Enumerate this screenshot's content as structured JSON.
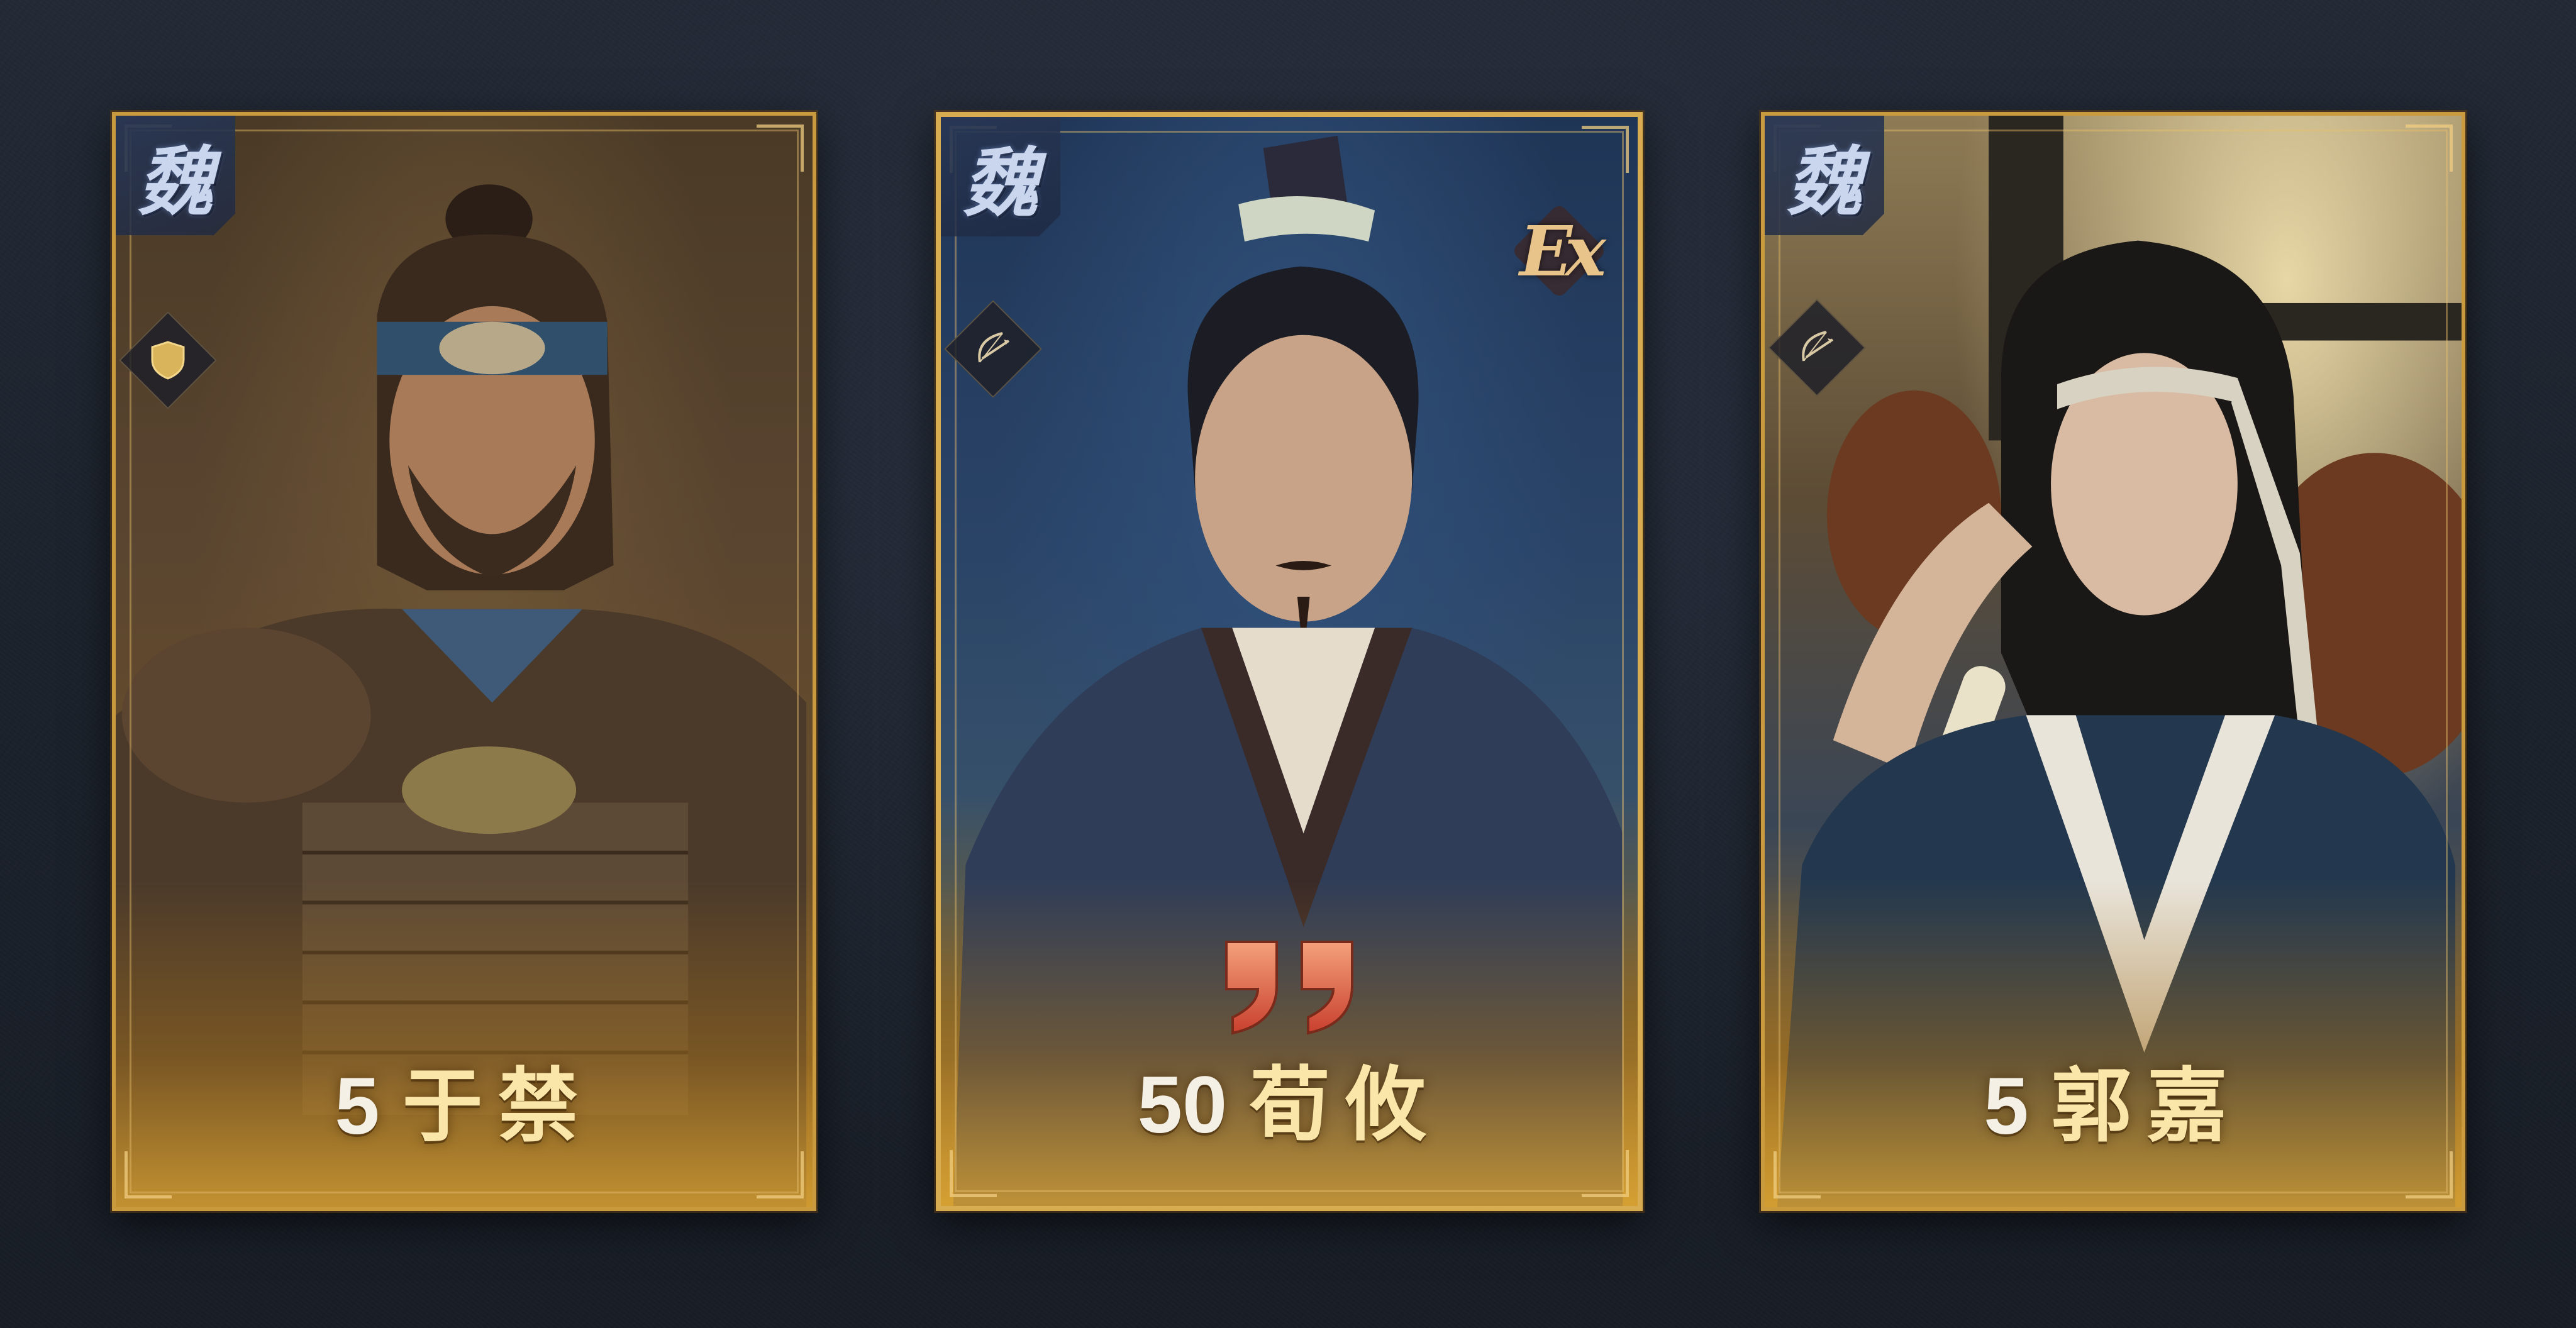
{
  "cards": [
    {
      "level": "5",
      "name": "于禁",
      "faction": "魏",
      "troop_icon": "shield-icon",
      "has_ex": false,
      "has_awaken_mark": false
    },
    {
      "level": "50",
      "name": "荀攸",
      "faction": "魏",
      "troop_icon": "bow-icon",
      "has_ex": true,
      "ex_label": "Ex",
      "has_awaken_mark": true,
      "awaken_icon": "double-quote-icon"
    },
    {
      "level": "5",
      "name": "郭嘉",
      "faction": "魏",
      "troop_icon": "bow-icon",
      "has_ex": false,
      "has_awaken_mark": false
    }
  ],
  "colors": {
    "frame_gold": "#c99a3e",
    "frame_gold_highlight": "#d8ad52",
    "faction_badge": "#2a3758",
    "name_text": "#fbe6a9",
    "awaken_red": "#e8604a"
  }
}
